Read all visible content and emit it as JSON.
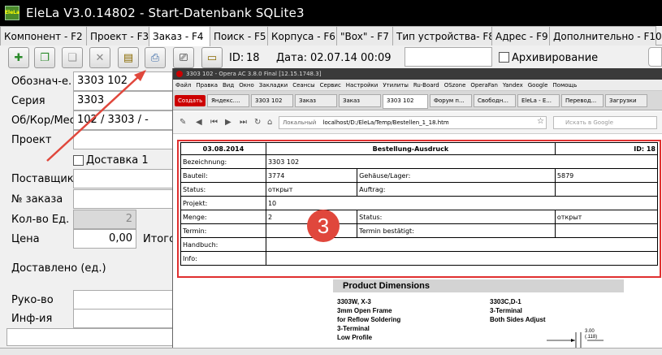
{
  "window": {
    "title": "EleLa V3.0.14802  - Start-Datenbank SQLite3",
    "logo_text": "EleLa"
  },
  "tabs": [
    {
      "label": "Компонент - F2"
    },
    {
      "label": "Проект - F3"
    },
    {
      "label": "Заказ - F4"
    },
    {
      "label": "Поиск - F5"
    },
    {
      "label": "Корпуса - F6"
    },
    {
      "label": "\"Box\" - F7"
    },
    {
      "label": "Тип устройства- F8"
    },
    {
      "label": "Адрес - F9"
    },
    {
      "label": "Дополнительно - F10"
    }
  ],
  "toolbar": {
    "id_label": "ID:",
    "id_value": "18",
    "date_label": "Дата:",
    "date_value": "02.07.14 00:09",
    "archive_label": "Архивирование"
  },
  "form": {
    "designation_label": "Обознач-е.",
    "designation_value": "3303 102",
    "series_label": "Серия",
    "series_value": "3303",
    "case_label": "Об/Кор/Мес",
    "case_value": "102 / 3303 / -",
    "project_label": "Проект",
    "delivery_label": "Доставка 1",
    "supplier_label": "Поставщик",
    "order_no_label": "№ заказа",
    "qty_label": "Кол-во Ед.",
    "qty_value": "2",
    "price_label": "Цена",
    "price_value": "0,00",
    "total_label": "Итого",
    "delivered_label": "Доставлено (ед.)",
    "manager_label": "Руко-во",
    "info_label": "Инф-ия"
  },
  "browser": {
    "title": "3303 102 - Opera AC 3.8.0 Final [12.15.1748.3]",
    "menu": [
      "Файл",
      "Правка",
      "Вид",
      "Окно",
      "Закладки",
      "Сеансы",
      "Сервис",
      "Настройки",
      "Утилиты",
      "Ru-Board",
      "OSzone",
      "OperaFan",
      "Yandex",
      "Google",
      "Помощь"
    ],
    "new_tab": "Создать",
    "tabs": [
      "Яндекс....",
      "3303 102",
      "Заказ",
      "Заказ",
      "3303 102",
      "Форум п...",
      "Свободн...",
      "EleLa - E...",
      "Перевод...",
      "Загрузки"
    ],
    "url_prefix": "Локальный",
    "url": "localhost/D:/EleLa/Temp/Bestellen_1_18.htm",
    "search_placeholder": "Искать в Google"
  },
  "printout": {
    "date": "03.08.2014",
    "heading": "Bestellung-Ausdruck",
    "id": "ID: 18",
    "bezeichnung_label": "Bezeichnung:",
    "bezeichnung_value": "3303 102",
    "bauteil_label": "Bauteil:",
    "bauteil_value": "3774",
    "gehaeuse_label": "Gehäuse/Lager:",
    "gehaeuse_value": "5879",
    "status_label": "Status:",
    "status_value": "открыт",
    "auftrag_label": "Auftrag:",
    "projekt_label": "Projekt:",
    "projekt_value": "10",
    "menge_label": "Menge:",
    "menge_value": "2",
    "status2_label": "Status:",
    "status2_value": "открыт",
    "termin_label": "Termin:",
    "termin_bestaetigt_label": "Termin bestätigt:",
    "handbuch_label": "Handbuch:",
    "info_label": "Info:"
  },
  "annotation": {
    "badge": "3",
    "color": "#e0473c"
  },
  "datasheet": {
    "header": "Product Dimensions",
    "left_lines": [
      "3303W, X-3",
      "3mm Open Frame",
      "for Reflow Soldering",
      "3-Terminal",
      "Low Profile"
    ],
    "right_lines": [
      "3303C,D-1",
      "3-Terminal",
      "Both Sides Adjust"
    ],
    "dim_value": "3.00",
    "dim_sub": "(.118)"
  }
}
